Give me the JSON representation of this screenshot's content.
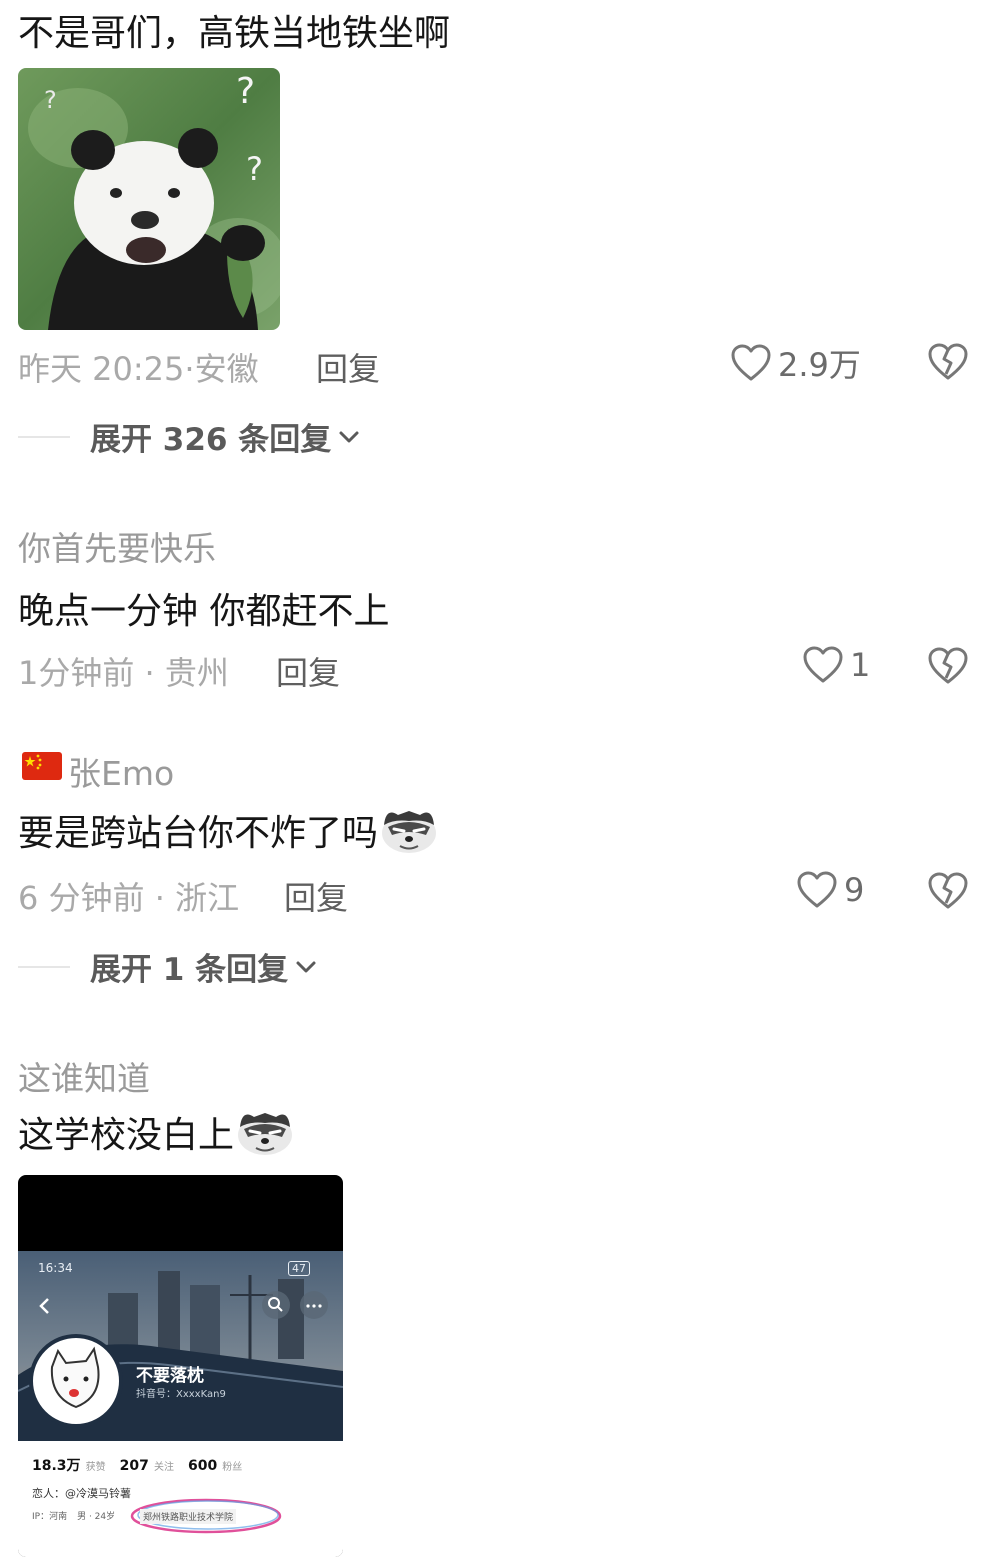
{
  "comments": [
    {
      "text": "不是哥们，高铁当地铁坐啊",
      "time": "昨天 20:25",
      "location": "安徽",
      "reply": "回复",
      "likes": "2.9万",
      "expand": "展开 326 条回复"
    },
    {
      "user": "你首先要快乐",
      "text": "晚点一分钟  你都赶不上",
      "time": "1分钟前",
      "location": "贵州",
      "reply": "回复",
      "likes": "1"
    },
    {
      "user": "张Emo",
      "text": "要是跨站台你不炸了吗",
      "time": "6 分钟前",
      "location": "浙江",
      "reply": "回复",
      "likes": "9",
      "expand": "展开 1 条回复"
    },
    {
      "user": "这谁知道",
      "text": "这学校没白上"
    }
  ],
  "meta_separator": "·",
  "screenshot": {
    "status_time": "16:34",
    "status_right": "47",
    "profile_name": "不要落枕",
    "douyin_id": "抖音号：XxxxKan9",
    "stats": [
      {
        "value": "18.3万",
        "label": "获赞"
      },
      {
        "value": "207",
        "label": "关注"
      },
      {
        "value": "600",
        "label": "粉丝"
      }
    ],
    "lover": "恋人：@冷漠马铃薯",
    "ip": "IP：河南",
    "gender_age": "男 · 24岁",
    "school": "郑州铁路职业技术学院"
  },
  "colors": {
    "accent_circle": "#e0509a",
    "panda_bg": "#5f8f4e",
    "text_secondary": "#9a9a9a"
  },
  "icons": {
    "like": "heart-outline-icon",
    "dislike": "broken-heart-icon",
    "expand": "chevron-down-icon",
    "flag": "china-flag-icon",
    "sticker": "smirking-dog-emoji"
  }
}
